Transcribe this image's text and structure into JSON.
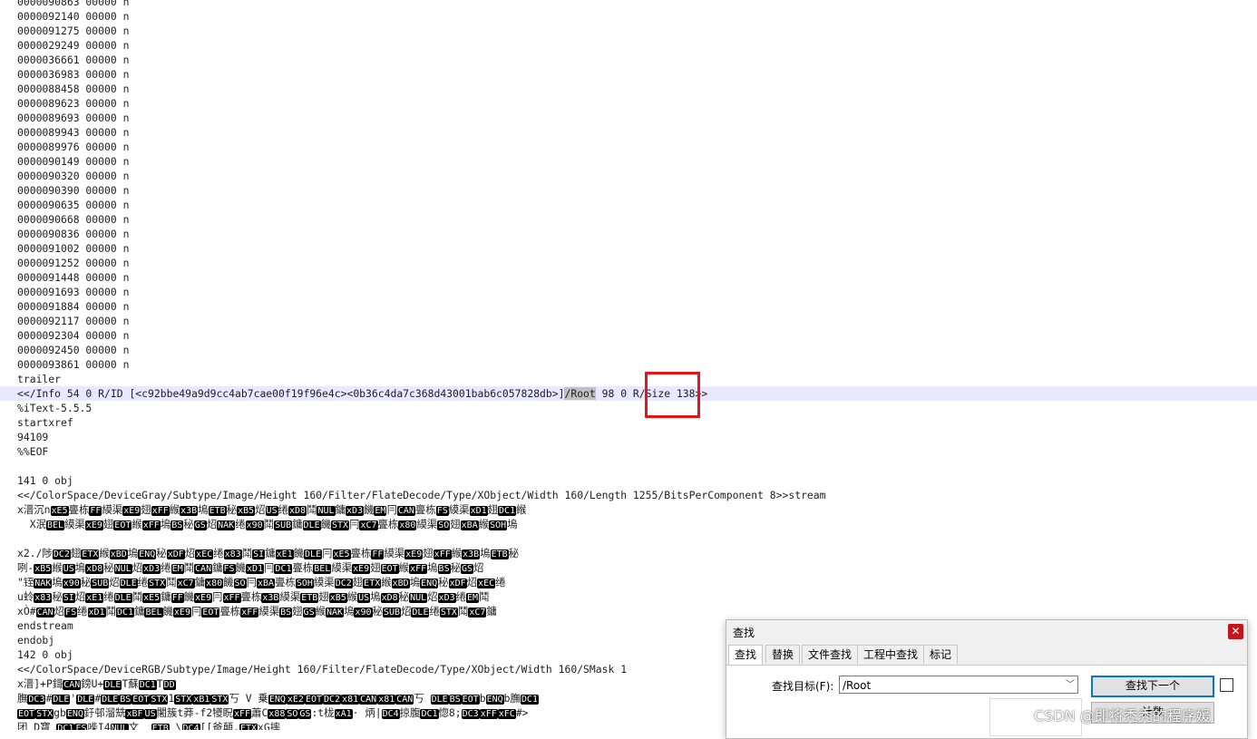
{
  "editor": {
    "xref_entries": [
      "0000090863 00000 n",
      "0000092140 00000 n",
      "0000091275 00000 n",
      "0000029249 00000 n",
      "0000036661 00000 n",
      "0000036983 00000 n",
      "0000088458 00000 n",
      "0000089623 00000 n",
      "0000089693 00000 n",
      "0000089943 00000 n",
      "0000089976 00000 n",
      "0000090149 00000 n",
      "0000090320 00000 n",
      "0000090390 00000 n",
      "0000090635 00000 n",
      "0000090668 00000 n",
      "0000090836 00000 n",
      "0000091002 00000 n",
      "0000091252 00000 n",
      "0000091448 00000 n",
      "0000091693 00000 n",
      "0000091884 00000 n",
      "0000092117 00000 n",
      "0000092304 00000 n",
      "0000092450 00000 n",
      "0000093861 00000 n"
    ],
    "trailer_keyword": "trailer",
    "trailer_dict_before": "<</Info 54 0 R/ID [<c92bbe49a9d9cc4ab7cae00f19f96e4c><0b36c4da7c368d43001bab6c057828db>]",
    "trailer_dict_match": "/Root",
    "trailer_dict_after": " 98 0 R/Size 138>>",
    "itext": "%iText-5.5.5",
    "startxref": "startxref",
    "startxref_value": "94109",
    "eof": "%%EOF",
    "obj141": "141 0 obj",
    "obj141_dict": "<</ColorSpace/DeviceGray/Subtype/Image/Height 160/Filter/FlateDecode/Type/XObject/Width 160/Length 1255/BitsPerComponent 8>>stream",
    "binary_lines": [
      "x溍沉n",
      "  X泯",
      "x2./陟",
      "咧-",
      "\"铚",
      "u蛉",
      "xÒ#"
    ],
    "ctl_tokens": [
      "xE5",
      "FF",
      "xE9",
      "xFF",
      "x3B",
      "ETB",
      "xB5",
      "US",
      "xD8",
      "NUL",
      "xD3",
      "EM",
      "CAN",
      "FS",
      "xD1",
      "DC1",
      "BEL",
      "xE9",
      "EOT",
      "xFF",
      "BS",
      "GS",
      "NAK",
      "x90",
      "SUB",
      "DLE",
      "STX",
      "xC7",
      "x80",
      "SO",
      "xBA",
      "SOH",
      "DC2",
      "ETX",
      "xBD",
      "ENQ",
      "xDF",
      "xEC",
      "x83",
      "SI",
      "xE1",
      "DLE"
    ],
    "endstream": "endstream",
    "endobj": "endobj",
    "obj142": "142 0 obj",
    "obj142_dict": "<</ColorSpace/DeviceRGB/Subtype/Image/Height 160/Filter/FlateDecode/Type/XObject/Width 160/SMask 1",
    "bin142_1": "x溍]+P鎶",
    "bin142_2": "膴",
    "bin142_3": "团 D寶"
  },
  "find_dialog": {
    "title": "查找",
    "close": "✕",
    "tabs": [
      "查找",
      "替换",
      "文件查找",
      "工程中查找",
      "标记"
    ],
    "find_label": "查找目标(F):",
    "find_value": "/Root",
    "find_next": "查找下一个",
    "count": "计数"
  },
  "watermark": "CSDN @即将秃秃的程序媛"
}
